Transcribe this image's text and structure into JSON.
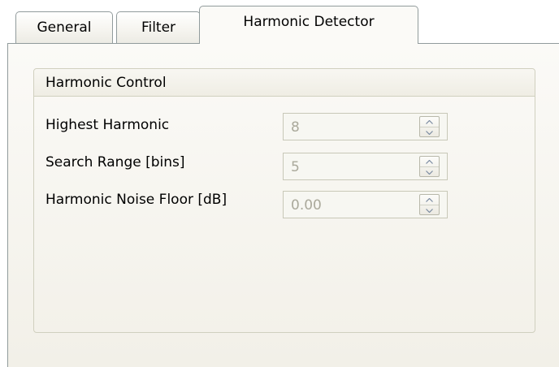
{
  "tabs": [
    {
      "label": "General"
    },
    {
      "label": "Filter"
    },
    {
      "label": "Harmonic Detector"
    }
  ],
  "active_tab": "Harmonic Detector",
  "group": {
    "title": "Harmonic Control",
    "fields": [
      {
        "label": "Highest Harmonic",
        "value": "8"
      },
      {
        "label": "Search Range [bins]",
        "value": "5"
      },
      {
        "label": "Harmonic Noise Floor [dB]",
        "value": "0.00"
      }
    ]
  },
  "icons": {
    "spin_up": "chevron-up-icon",
    "spin_down": "chevron-down-icon"
  },
  "colors": {
    "panel_background": "#f7f5ef",
    "disabled_text": "#aaa99b",
    "border": "#919b9c"
  }
}
